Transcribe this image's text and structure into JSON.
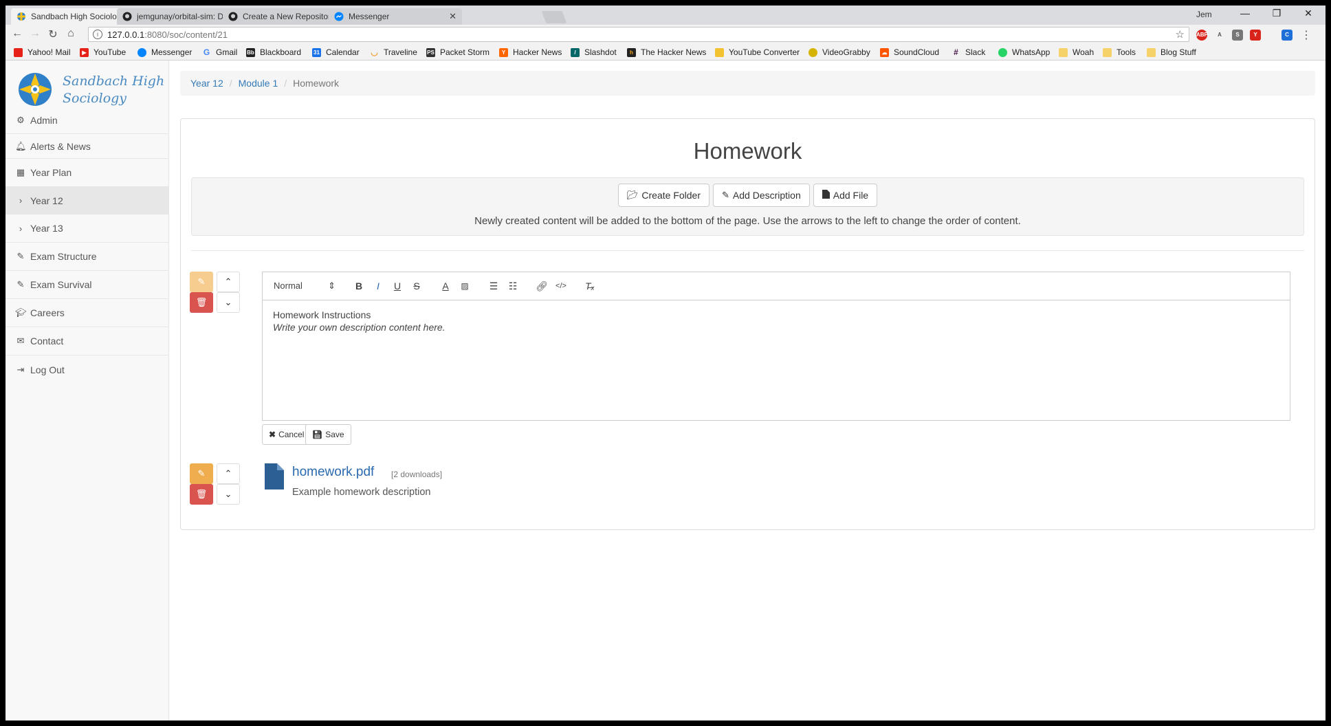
{
  "browser": {
    "tabs": [
      {
        "title": "Sandbach High Sociolog",
        "icon": "site-logo-icon",
        "active": true
      },
      {
        "title": "jemgunay/orbital-sim: D",
        "icon": "github-icon",
        "active": false
      },
      {
        "title": "Create a New Repository",
        "icon": "github-icon",
        "active": false
      },
      {
        "title": "Messenger",
        "icon": "messenger-icon",
        "active": false
      }
    ],
    "tab_close": "✕",
    "user": "Jem",
    "url_host": "127.0.0.1",
    "url_path": ":8080/soc/content/21",
    "extensions": [
      "ABP",
      "A",
      "S",
      "Y",
      "C"
    ],
    "bookmarks": [
      {
        "label": "Yahoo! Mail",
        "color": "#e62117"
      },
      {
        "label": "YouTube",
        "color": "#e62117"
      },
      {
        "label": "Messenger",
        "color": "#0084ff"
      },
      {
        "label": "Gmail",
        "color": "#4285f4"
      },
      {
        "label": "Blackboard",
        "color": "#222222"
      },
      {
        "label": "Calendar",
        "color": "#1a73e8"
      },
      {
        "label": "Traveline",
        "color": "#f0a030"
      },
      {
        "label": "Packet Storm",
        "color": "#333333"
      },
      {
        "label": "Hacker News",
        "color": "#ff6600"
      },
      {
        "label": "Slashdot",
        "color": "#006666"
      },
      {
        "label": "The Hacker News",
        "color": "#222222"
      },
      {
        "label": "YouTube Converter",
        "color": "#f2c230"
      },
      {
        "label": "VideoGrabby",
        "color": "#d4b400"
      },
      {
        "label": "SoundCloud",
        "color": "#ff5500"
      },
      {
        "label": "Slack",
        "color": "#4a154b"
      },
      {
        "label": "WhatsApp",
        "color": "#25d366"
      },
      {
        "label": "Woah",
        "color": "#f5d36a"
      },
      {
        "label": "Tools",
        "color": "#f5d36a"
      },
      {
        "label": "Blog Stuff",
        "color": "#f5d36a"
      }
    ]
  },
  "site": {
    "brand_line1": "Sandbach High",
    "brand_line2": "Sociology"
  },
  "sidebar": {
    "items": [
      {
        "label": "Admin",
        "icon": "gear-icon"
      },
      {
        "label": "Alerts & News",
        "icon": "bell-icon"
      },
      {
        "label": "Year Plan",
        "icon": "calendar-icon"
      },
      {
        "label": "Year 12",
        "icon": "chevron-right-icon",
        "active": true
      },
      {
        "label": "Year 13",
        "icon": "chevron-right-icon"
      },
      {
        "label": "Exam Structure",
        "icon": "pencil-icon"
      },
      {
        "label": "Exam Survival",
        "icon": "pencil-icon"
      },
      {
        "label": "Careers",
        "icon": "graduation-cap-icon"
      },
      {
        "label": "Contact",
        "icon": "envelope-icon"
      },
      {
        "label": "Log Out",
        "icon": "sign-out-icon"
      }
    ]
  },
  "breadcrumb": {
    "items": [
      "Year 12",
      "Module 1"
    ],
    "current": "Homework",
    "separator": "/"
  },
  "main": {
    "title": "Homework",
    "actions": {
      "create_folder": "Create Folder",
      "add_description": "Add Description",
      "add_file": "Add File"
    },
    "note": "Newly created content will be added to the bottom of the page. Use the arrows to the left to change the order of content.",
    "editor": {
      "format_select": "Normal",
      "heading": "Homework Instructions",
      "body": "Write your own description content here.",
      "cancel_label": "Cancel",
      "save_label": "Save"
    },
    "file": {
      "name": "homework.pdf",
      "downloads": "[2 downloads]",
      "description": "Example homework description"
    }
  },
  "colors": {
    "link": "#337ab7",
    "edit_button": "#f0ad4e",
    "delete_button": "#d9534f",
    "brand": "#4a8ac2"
  }
}
